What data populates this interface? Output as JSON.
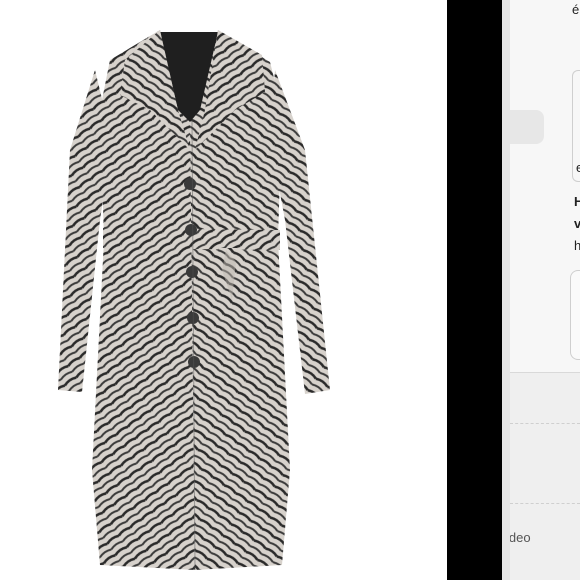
{
  "right_panel": {
    "top_char": "é",
    "line_e": "e",
    "line_h": "H",
    "line_v": "v",
    "line_h2": "h",
    "video_label": "ideo"
  },
  "colors": {
    "divider": "#000000",
    "panel_bg": "#f3f3f3",
    "coat_base": "#cfcac4",
    "coat_dark": "#2b2b2b"
  },
  "icons": [
    "coat-product-image"
  ]
}
